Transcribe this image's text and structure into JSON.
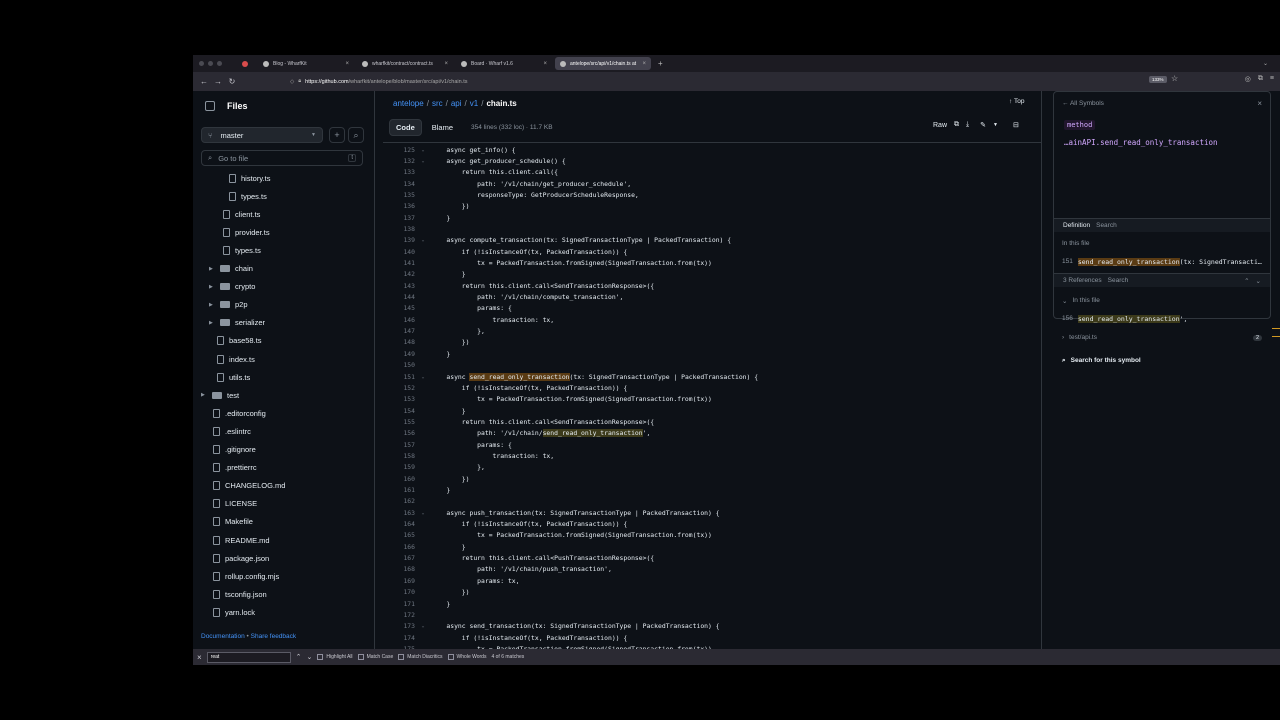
{
  "tabs": [
    {
      "title": "",
      "active": false
    },
    {
      "title": "Blog - WharfKit",
      "active": false
    },
    {
      "title": "wharfkit/contract/contract.ts",
      "active": false
    },
    {
      "title": "Board · Wharf v1.6",
      "active": false
    },
    {
      "title": "antelope/src/api/v1/chain.ts at",
      "active": true
    }
  ],
  "address": {
    "host": "https://github.com",
    "path": "/wharfkit/antelope/blob/master/src/api/v1/chain.ts",
    "zoom": "133%"
  },
  "sidebar": {
    "title": "Files",
    "branch": "master",
    "goto_placeholder": "Go to file",
    "goto_key": "t",
    "items": [
      {
        "label": "history.ts",
        "type": "file"
      },
      {
        "label": "types.ts",
        "type": "file"
      },
      {
        "label": "client.ts",
        "type": "file"
      },
      {
        "label": "provider.ts",
        "type": "file"
      },
      {
        "label": "types.ts",
        "type": "file"
      },
      {
        "label": "chain",
        "type": "dir"
      },
      {
        "label": "crypto",
        "type": "dir"
      },
      {
        "label": "p2p",
        "type": "dir"
      },
      {
        "label": "serializer",
        "type": "dir"
      },
      {
        "label": "base58.ts",
        "type": "file"
      },
      {
        "label": "index.ts",
        "type": "file"
      },
      {
        "label": "utils.ts",
        "type": "file"
      },
      {
        "label": "test",
        "type": "dir"
      },
      {
        "label": ".editorconfig",
        "type": "file"
      },
      {
        "label": ".eslintrc",
        "type": "file"
      },
      {
        "label": ".gitignore",
        "type": "file"
      },
      {
        "label": ".prettierrc",
        "type": "file"
      },
      {
        "label": "CHANGELOG.md",
        "type": "file"
      },
      {
        "label": "LICENSE",
        "type": "file"
      },
      {
        "label": "Makefile",
        "type": "file"
      },
      {
        "label": "README.md",
        "type": "file"
      },
      {
        "label": "package.json",
        "type": "file"
      },
      {
        "label": "rollup.config.mjs",
        "type": "file"
      },
      {
        "label": "tsconfig.json",
        "type": "file"
      },
      {
        "label": "yarn.lock",
        "type": "file"
      }
    ],
    "footer_docs": "Documentation",
    "footer_sep": " • ",
    "footer_feedback": "Share feedback"
  },
  "breadcrumb": {
    "repo": "antelope",
    "p1": "src",
    "p2": "api",
    "p3": "v1",
    "file": "chain.ts",
    "sep": "/"
  },
  "top_label": "Top",
  "view": {
    "code": "Code",
    "blame": "Blame",
    "meta": "354 lines (332 loc) · 11.7 KB",
    "raw": "Raw"
  },
  "code_lines": [
    {
      "n": "125",
      "t": "    async get_info() {"
    },
    {
      "n": "132",
      "t": "    async get_producer_schedule() {"
    },
    {
      "n": "133",
      "t": "        return this.client.call({"
    },
    {
      "n": "134",
      "t": "            path: '/v1/chain/get_producer_schedule',"
    },
    {
      "n": "135",
      "t": "            responseType: GetProducerScheduleResponse,"
    },
    {
      "n": "136",
      "t": "        })"
    },
    {
      "n": "137",
      "t": "    }"
    },
    {
      "n": "138",
      "t": ""
    },
    {
      "n": "139",
      "t": "    async compute_transaction(tx: SignedTransactionType | PackedTransaction) {"
    },
    {
      "n": "140",
      "t": "        if (!isInstanceOf(tx, PackedTransaction)) {"
    },
    {
      "n": "141",
      "t": "            tx = PackedTransaction.fromSigned(SignedTransaction.from(tx))"
    },
    {
      "n": "142",
      "t": "        }"
    },
    {
      "n": "143",
      "t": "        return this.client.call<SendTransactionResponse>({"
    },
    {
      "n": "144",
      "t": "            path: '/v1/chain/compute_transaction',"
    },
    {
      "n": "145",
      "t": "            params: {"
    },
    {
      "n": "146",
      "t": "                transaction: tx,"
    },
    {
      "n": "147",
      "t": "            },"
    },
    {
      "n": "148",
      "t": "        })"
    },
    {
      "n": "149",
      "t": "    }"
    },
    {
      "n": "150",
      "t": ""
    },
    {
      "n": "151",
      "t": "    async send_read_only_transaction(tx: SignedTransactionType | PackedTransaction) {"
    },
    {
      "n": "152",
      "t": "        if (!isInstanceOf(tx, PackedTransaction)) {"
    },
    {
      "n": "153",
      "t": "            tx = PackedTransaction.fromSigned(SignedTransaction.from(tx))"
    },
    {
      "n": "154",
      "t": "        }"
    },
    {
      "n": "155",
      "t": "        return this.client.call<SendTransactionResponse>({"
    },
    {
      "n": "156",
      "t": "            path: '/v1/chain/send_read_only_transaction',"
    },
    {
      "n": "157",
      "t": "            params: {"
    },
    {
      "n": "158",
      "t": "                transaction: tx,"
    },
    {
      "n": "159",
      "t": "            },"
    },
    {
      "n": "160",
      "t": "        })"
    },
    {
      "n": "161",
      "t": "    }"
    },
    {
      "n": "162",
      "t": ""
    },
    {
      "n": "163",
      "t": "    async push_transaction(tx: SignedTransactionType | PackedTransaction) {"
    },
    {
      "n": "164",
      "t": "        if (!isInstanceOf(tx, PackedTransaction)) {"
    },
    {
      "n": "165",
      "t": "            tx = PackedTransaction.fromSigned(SignedTransaction.from(tx))"
    },
    {
      "n": "166",
      "t": "        }"
    },
    {
      "n": "167",
      "t": "        return this.client.call<PushTransactionResponse>({"
    },
    {
      "n": "168",
      "t": "            path: '/v1/chain/push_transaction',"
    },
    {
      "n": "169",
      "t": "            params: tx,"
    },
    {
      "n": "170",
      "t": "        })"
    },
    {
      "n": "171",
      "t": "    }"
    },
    {
      "n": "172",
      "t": ""
    },
    {
      "n": "173",
      "t": "    async send_transaction(tx: SignedTransactionType | PackedTransaction) {"
    },
    {
      "n": "174",
      "t": "        if (!isInstanceOf(tx, PackedTransaction)) {"
    },
    {
      "n": "175",
      "t": "            tx = PackedTransaction.fromSigned(SignedTransaction.from(tx))"
    }
  ],
  "fold_rows": [
    "125",
    "132",
    "139",
    "151",
    "163",
    "173"
  ],
  "highlight": {
    "line": "151",
    "token": "send_read_only_transaction"
  },
  "highlight2": {
    "line": "156",
    "token": "send_read_only_transaction"
  },
  "symbols": {
    "back": "All Symbols",
    "kind": "method",
    "signature": "…ainAPI.send_read_only_transaction",
    "definition": "Definition",
    "search": "Search",
    "in_file": "In this file",
    "def_line": "151",
    "def_symbol": "send_read_only_transaction",
    "def_rest": "(tx: SignedTransacti…",
    "refs": "3 References",
    "refs_in_file": "In this file",
    "ref_line": "156",
    "ref_symbol": "send_read_only_transaction",
    "ref_rest": "',",
    "other_file": "test/api.ts",
    "other_count": "2",
    "search_symbol": "Search for this symbol"
  },
  "find": {
    "value": "reat",
    "highlight_all": "Highlight All",
    "match_case": "Match Case",
    "diacritics": "Match Diacritics",
    "whole_words": "Whole Words",
    "status": "4 of 6 matches"
  }
}
